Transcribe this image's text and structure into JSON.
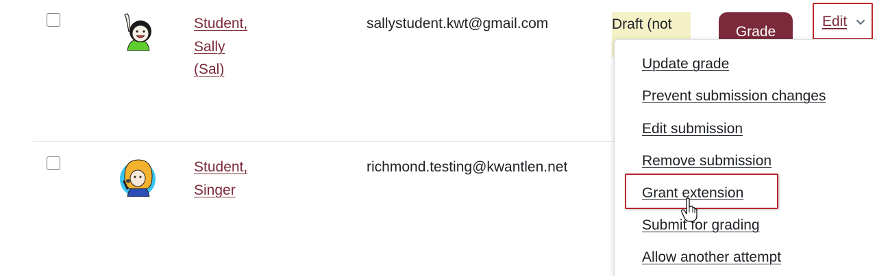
{
  "rows": [
    {
      "name_parts": [
        "Student,",
        "Sally",
        "(Sal)"
      ],
      "email": "sallystudent.kwt@gmail.com",
      "status_text": "Draft (not",
      "grade_label": "Grade",
      "edit_label": "Edit"
    },
    {
      "name_parts": [
        "Student,",
        "Singer"
      ],
      "email": "richmond.testing@kwantlen.net"
    }
  ],
  "edit_menu": {
    "items": [
      "Update grade",
      "Prevent submission changes",
      "Edit submission",
      "Remove submission",
      "Grant extension",
      "Submit for grading",
      "Allow another attempt"
    ],
    "highlighted_item": "Grant extension"
  },
  "colors": {
    "brand": "#7b2a3b",
    "draft_status_bg": "#f5f1c7",
    "highlight_border": "#c0272d"
  },
  "icons": {
    "checkbox": "checkbox-icon",
    "chevron": "chevron-down-icon",
    "cursor": "hand-pointer-icon"
  }
}
